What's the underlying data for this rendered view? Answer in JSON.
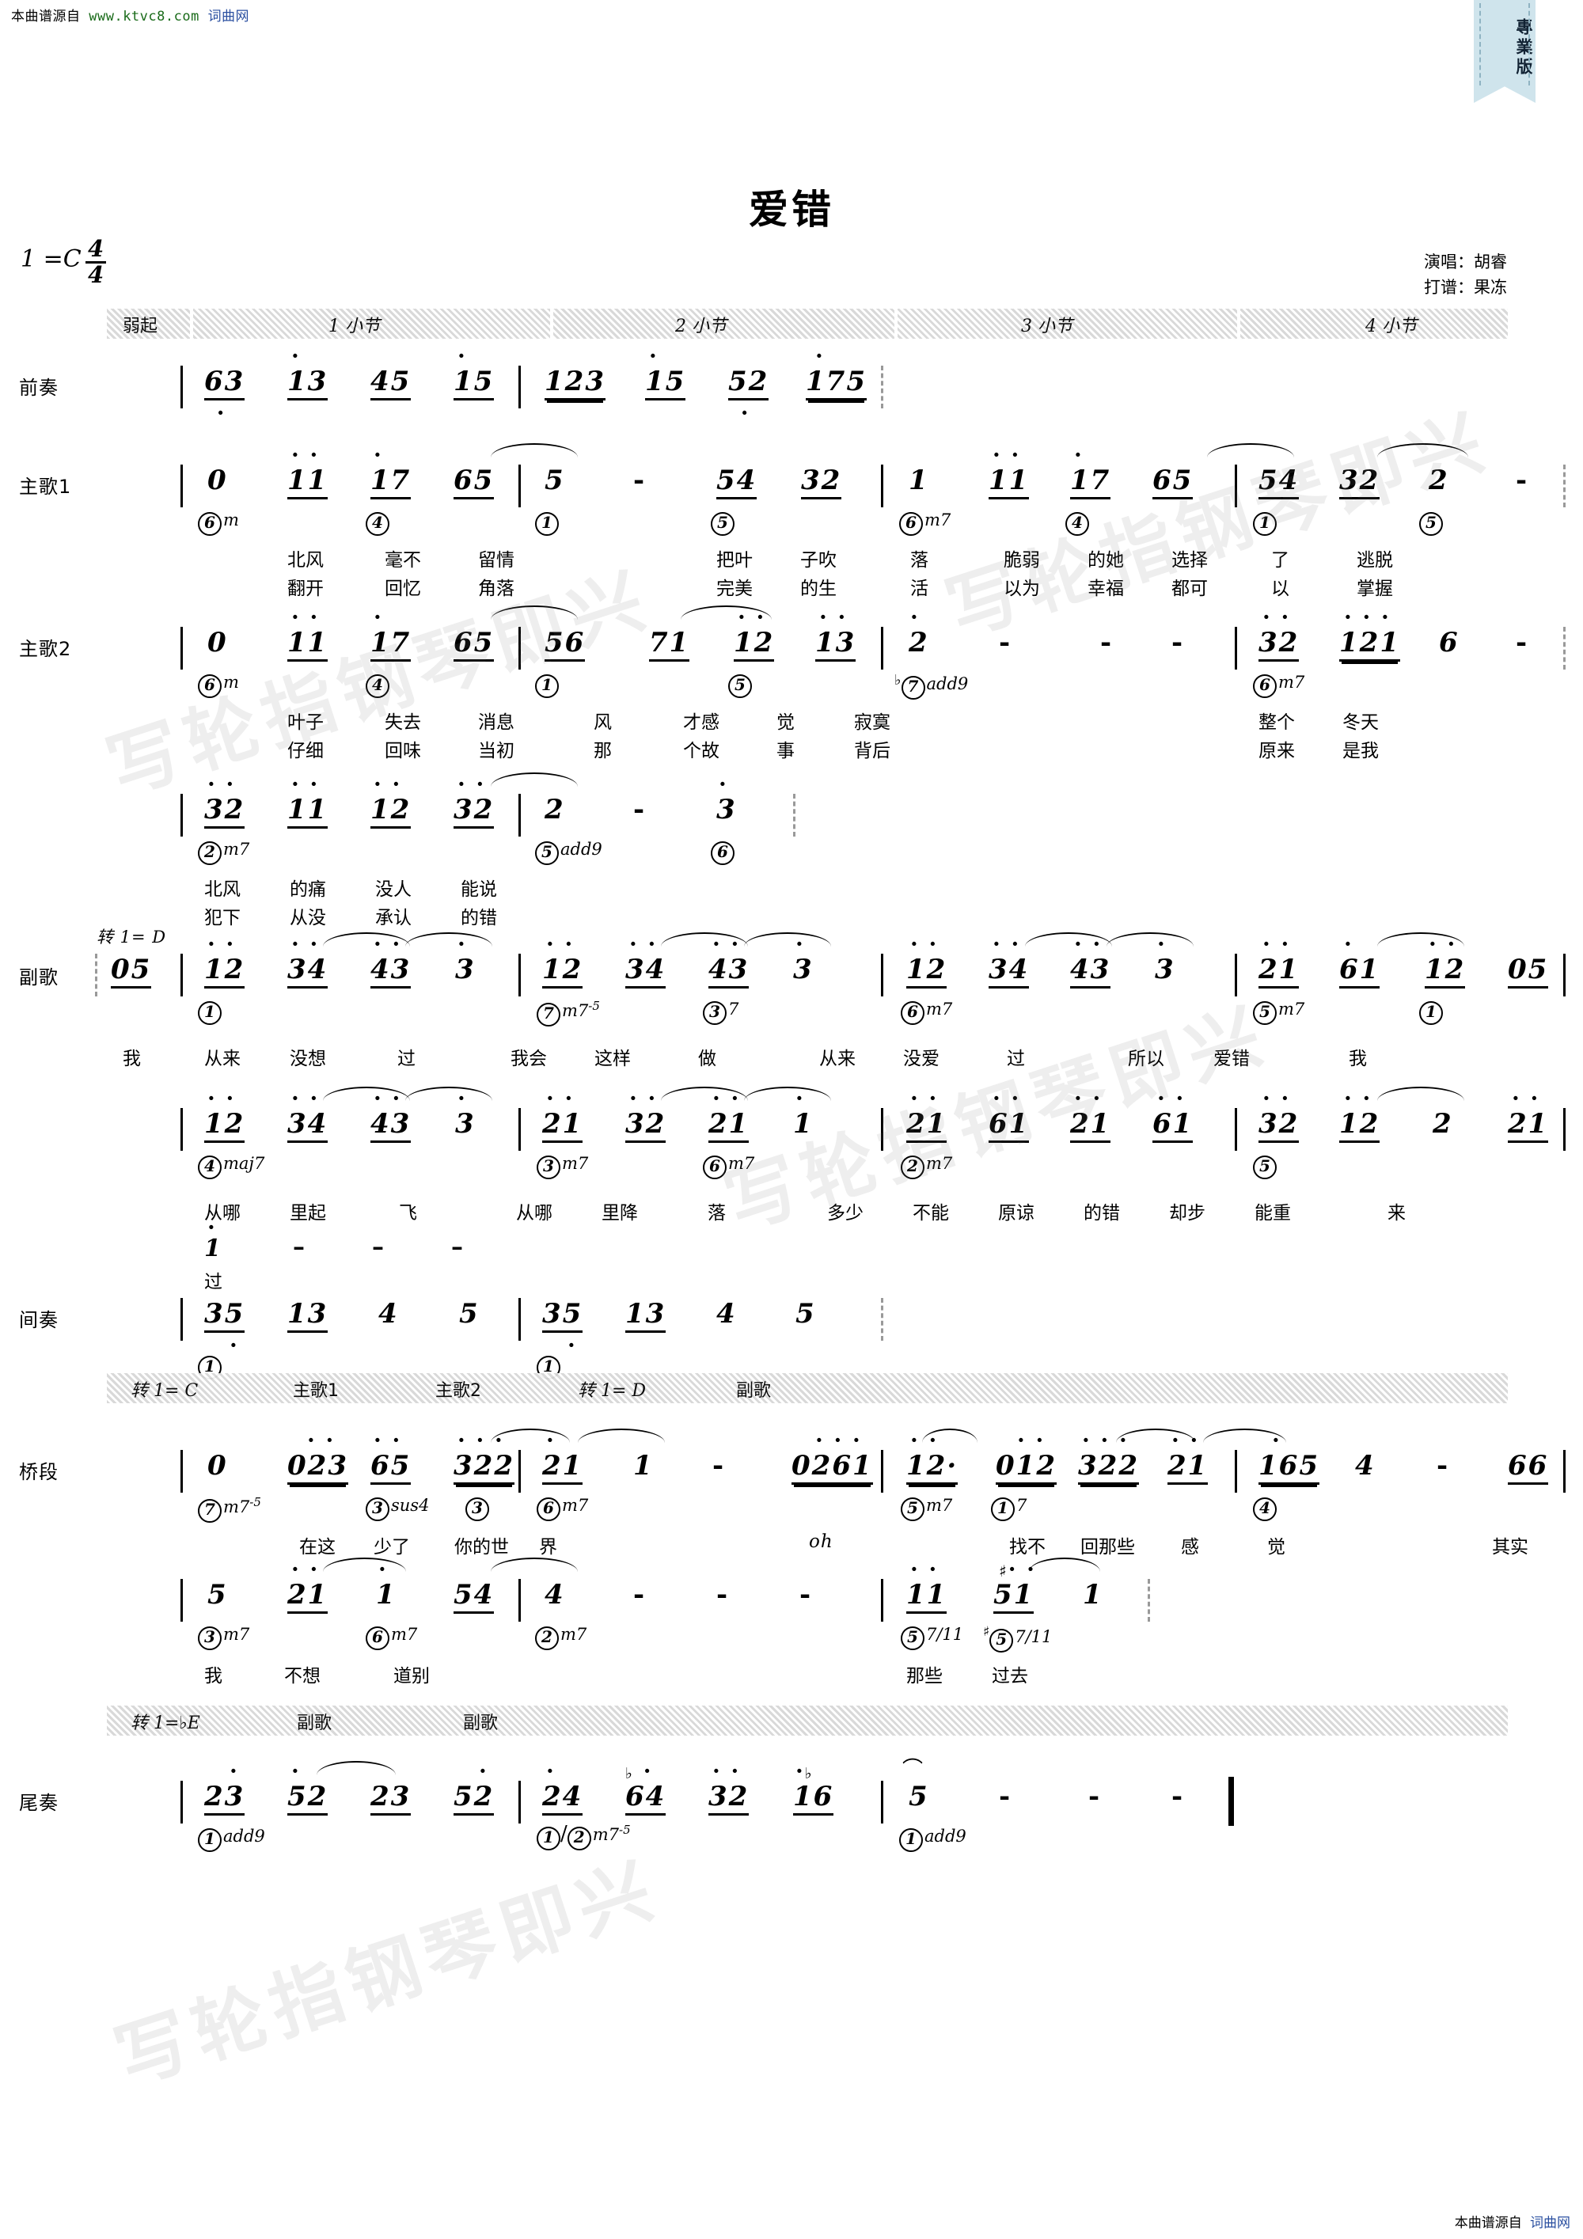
{
  "source_line": {
    "prefix": "本曲谱源自",
    "url": "www.ktvc8.com",
    "site": "词曲网"
  },
  "ribbon": {
    "label": "專業版"
  },
  "title": "爱错",
  "credits": {
    "singer": "演唱：胡睿",
    "transcriber": "打谱：果冻"
  },
  "key_signature": {
    "text": "1 =C",
    "meter_num": "4",
    "meter_den": "4"
  },
  "measure_banner": {
    "cells": [
      "弱起",
      "1 小节",
      "2 小节",
      "3 小节",
      "4 小节"
    ]
  },
  "bridge_banner": {
    "cells": [
      "转 1= C",
      "主歌1",
      "主歌2",
      "转 1= D",
      "副歌"
    ]
  },
  "coda_banner": {
    "cells": [
      "转 1=♭E",
      "副歌",
      "副歌"
    ]
  },
  "row_labels": {
    "prelude": "前奏",
    "verse1": "主歌1",
    "verse2": "主歌2",
    "chorus": "副歌",
    "interlude": "间奏",
    "bridge": "桥段",
    "coda": "尾奏"
  },
  "modulations": {
    "to_D": "转 1= D"
  },
  "rows": [
    {
      "id": "prelude",
      "label": "前奏",
      "notes": "| 63 13 45 15 | 123 15 52 175",
      "groups": [
        "63",
        "13",
        "45",
        "15",
        "123",
        "15",
        "52",
        "175"
      ],
      "chords": [],
      "lyrics_1": [],
      "lyrics_2": []
    },
    {
      "id": "verse1",
      "label": "主歌1",
      "groups": [
        "0",
        "11",
        "17",
        "65",
        "5",
        "-",
        "54",
        "32",
        "1",
        "11",
        "17",
        "65",
        "54",
        "32",
        "2",
        "-"
      ],
      "chords": [
        "⑥m",
        "④",
        "①",
        "⑤",
        "⑥m7",
        "④",
        "①",
        "⑤"
      ],
      "lyrics_1": [
        "北风",
        "毫不",
        "留情",
        "把叶",
        "子吹",
        "落",
        "脆弱",
        "的她",
        "选择",
        "了",
        "逃脱"
      ],
      "lyrics_2": [
        "翻开",
        "回忆",
        "角落",
        "完美",
        "的生",
        "活",
        "以为",
        "幸福",
        "都可",
        "以",
        "掌握"
      ]
    },
    {
      "id": "verse2a",
      "label": "主歌2",
      "groups": [
        "0",
        "11",
        "17",
        "65",
        "56",
        "71",
        "12",
        "13",
        "2",
        "-",
        "-",
        "-",
        "32",
        "121",
        "6",
        "-"
      ],
      "chords": [
        "⑥m",
        "④",
        "①",
        "⑤",
        "♭⑦add9",
        "⑥m7"
      ],
      "lyrics_1": [
        "叶子",
        "失去",
        "消息",
        "风",
        "才感",
        "觉",
        "寂寞",
        "整个",
        "冬天"
      ],
      "lyrics_2": [
        "仔细",
        "回味",
        "当初",
        "那",
        "个故",
        "事",
        "背后",
        "原来",
        "是我"
      ]
    },
    {
      "id": "verse2b",
      "label": "",
      "groups": [
        "32",
        "11",
        "12",
        "32",
        "2",
        "-",
        "3"
      ],
      "chords": [
        "②m7",
        "⑤add9",
        "⑥"
      ],
      "lyrics_1": [
        "北风",
        "的痛",
        "没人",
        "能说"
      ],
      "lyrics_2": [
        "犯下",
        "从没",
        "承认",
        "的错"
      ]
    },
    {
      "id": "chorus1",
      "label": "副歌",
      "pickup": "05",
      "groups": [
        "12",
        "34",
        "43",
        "3",
        "12",
        "34",
        "43",
        "3",
        "12",
        "34",
        "43",
        "3",
        "21",
        "61",
        "12",
        "05"
      ],
      "chords": [
        "①",
        "⑦m7-5",
        "③7",
        "⑥m7",
        "⑤m7",
        "①"
      ],
      "lyrics_1": [
        "我",
        "从来",
        "没想",
        "过",
        "我会",
        "这样",
        "做",
        "从来",
        "没爱",
        "过",
        "所以",
        "爱错",
        "我"
      ]
    },
    {
      "id": "chorus2",
      "label": "",
      "groups": [
        "12",
        "34",
        "43",
        "3",
        "21",
        "32",
        "21",
        "1",
        "21",
        "61",
        "21",
        "61",
        "32",
        "12",
        "2",
        "21"
      ],
      "chords": [
        "④maj7",
        "③m7",
        "⑥m7",
        "②m7",
        "⑤"
      ],
      "lyrics_1": [
        "从哪",
        "里起",
        "飞",
        "从哪",
        "里降",
        "落",
        "多少",
        "不能",
        "原谅",
        "的错",
        "却步",
        "能重",
        "来"
      ],
      "tail": {
        "note": "1",
        "dashes": "— —",
        "lyric": "过"
      }
    },
    {
      "id": "interlude",
      "label": "间奏",
      "groups": [
        "35",
        "13",
        "4",
        "5",
        "35",
        "13",
        "4",
        "5"
      ],
      "chords": [
        "①",
        "①"
      ]
    },
    {
      "id": "bridge1",
      "label": "桥段",
      "groups": [
        "0",
        "023",
        "65",
        "322",
        "21",
        "1",
        "-",
        "0261",
        "12·",
        "012",
        "322",
        "21",
        "165",
        "4",
        "-",
        "66"
      ],
      "chords": [
        "⑦m7-5",
        "③sus4",
        "③",
        "⑥m7",
        "⑤m7",
        "①7",
        "④"
      ],
      "lyrics_1": [
        "在这",
        "少了",
        "你的世",
        "界",
        "oh",
        "找不",
        "回那些",
        "感",
        "觉",
        "其实"
      ]
    },
    {
      "id": "bridge2",
      "label": "",
      "groups": [
        "5",
        "21",
        "1",
        "54",
        "4",
        "-",
        "-",
        "-",
        "11",
        "51",
        "1"
      ],
      "chords": [
        "③m7",
        "⑥m7",
        "②m7",
        "⑤7/11",
        "#⑤7/11"
      ],
      "lyrics_1": [
        "我",
        "不想",
        "道别",
        "那些",
        "过去"
      ]
    },
    {
      "id": "coda",
      "label": "尾奏",
      "groups": [
        "23",
        "52",
        "23",
        "52",
        "24",
        "64",
        "32",
        "16",
        "5",
        "-",
        "-",
        "-"
      ],
      "chords": [
        "①add9",
        "①/②m7-5",
        "①add9"
      ]
    }
  ],
  "watermarks": [
    "写轮指钢琴即兴",
    "写轮指钢琴即兴",
    "写轮指钢琴即兴",
    "写轮指钢琴即兴"
  ],
  "footer": {
    "prefix": "本曲谱源自",
    "site": "词曲网"
  }
}
